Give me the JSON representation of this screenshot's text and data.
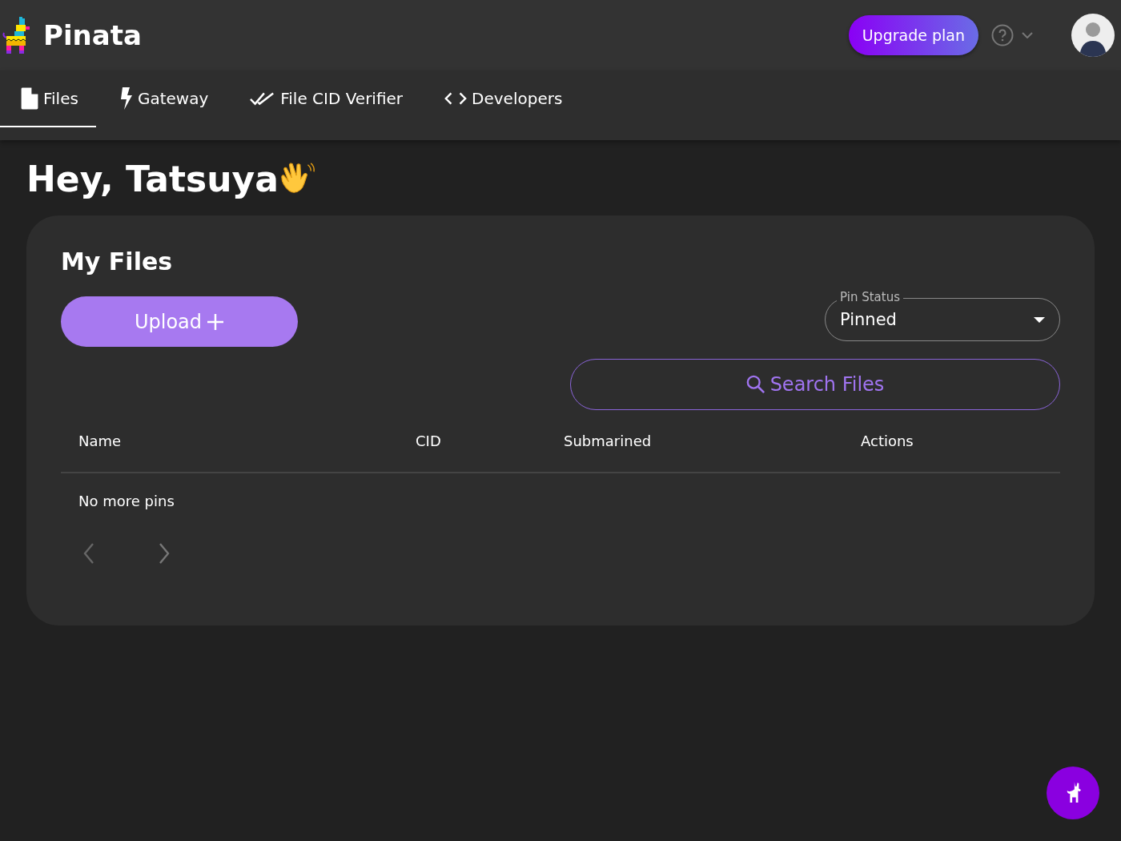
{
  "header": {
    "brand": "Pinata",
    "upgrade_button": "Upgrade plan"
  },
  "tabs": [
    {
      "label": "Files",
      "kind": "file",
      "selected": true
    },
    {
      "label": "Gateway",
      "kind": "gateway",
      "selected": false
    },
    {
      "label": "File CID Verifier",
      "kind": "verifier",
      "selected": false
    },
    {
      "label": "Developers",
      "kind": "developers",
      "selected": false
    }
  ],
  "greeting": "Hey, Tatsuya",
  "files_card": {
    "title": "My Files",
    "upload_button": "Upload",
    "pin_status": {
      "label": "Pin Status",
      "value": "Pinned"
    },
    "search_button": "Search Files",
    "table": {
      "columns": [
        "Name",
        "CID",
        "Submarined",
        "Actions"
      ],
      "empty_message": "No more pins"
    }
  }
}
